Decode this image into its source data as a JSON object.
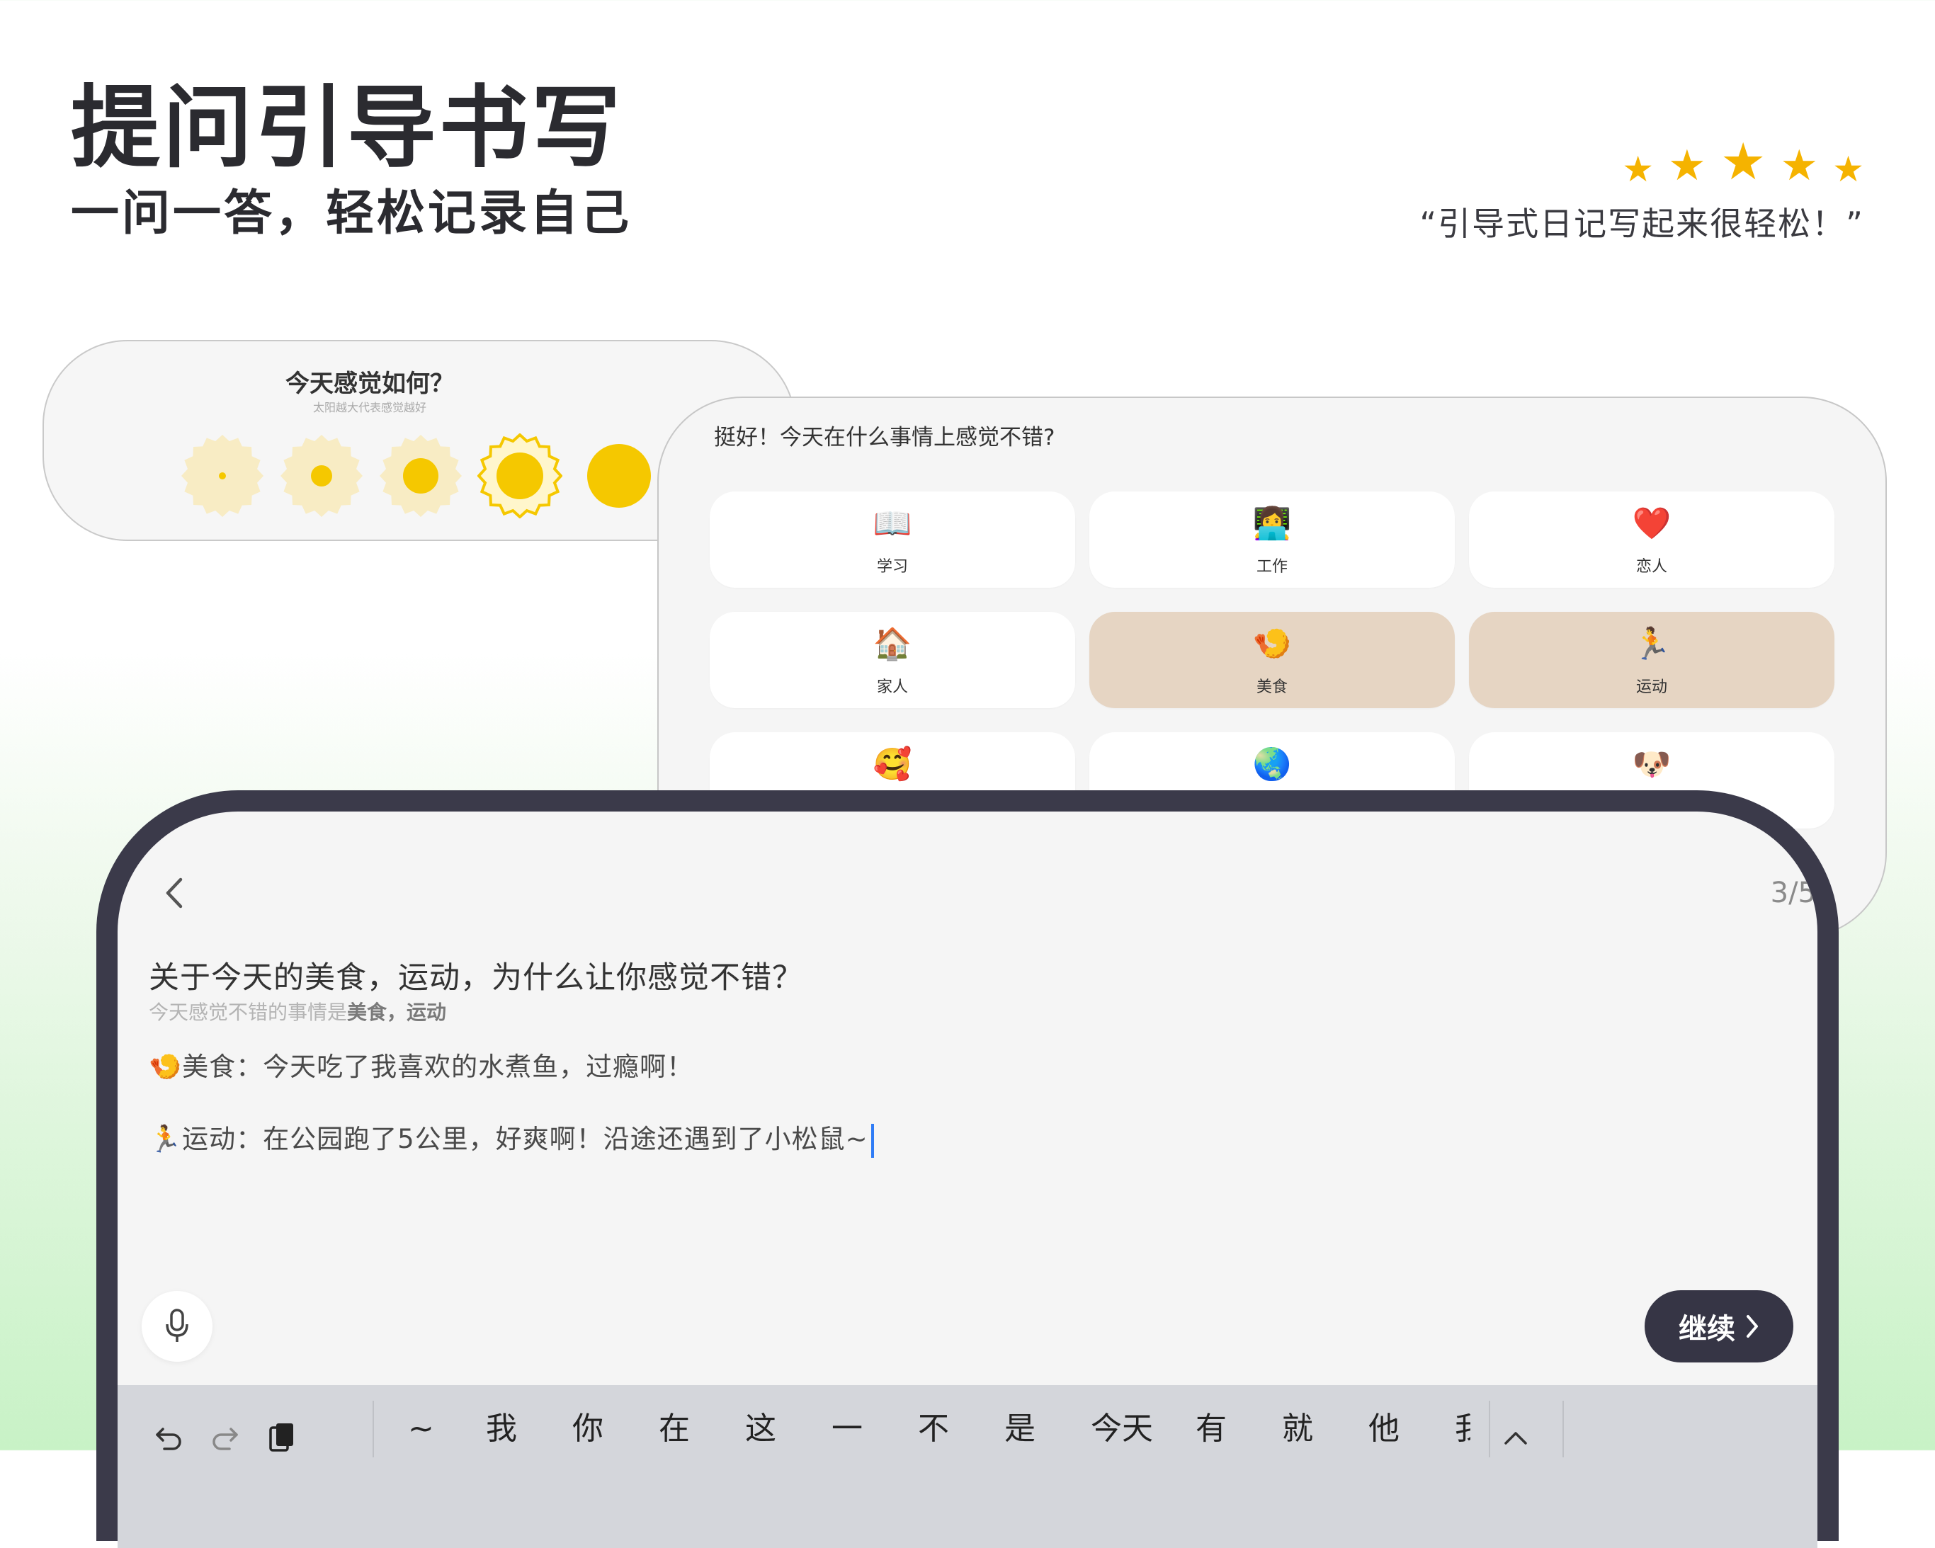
{
  "hero": {
    "title": "提问引导书写",
    "subtitle": "一问一答，轻松记录自己",
    "quote": "“引导式日记写起来很轻松！”",
    "rating_stars": 5
  },
  "feeling_card": {
    "title": "今天感觉如何？",
    "subtitle": "太阳越大代表感觉越好",
    "options": [
      1,
      2,
      3,
      4,
      5
    ],
    "selected": 4,
    "sun_color": "#f5c800"
  },
  "category_card": {
    "question": "挺好！今天在什么事情上感觉不错?",
    "categories": [
      {
        "icon": "📖",
        "icon_name": "book-icon",
        "label": "学习",
        "selected": false
      },
      {
        "icon": "👩‍💻",
        "icon_name": "technologist-icon",
        "label": "工作",
        "selected": false
      },
      {
        "icon": "❤️",
        "icon_name": "heart-icon",
        "label": "恋人",
        "selected": false
      },
      {
        "icon": "🏠",
        "icon_name": "house-icon",
        "label": "家人",
        "selected": false
      },
      {
        "icon": "🍤",
        "icon_name": "fried-shrimp-icon",
        "label": "美食",
        "selected": true
      },
      {
        "icon": "🏃",
        "icon_name": "runner-icon",
        "label": "运动",
        "selected": true
      },
      {
        "icon": "🥰",
        "icon_name": "smiling-hearts-icon",
        "label": "",
        "selected": false
      },
      {
        "icon": "🌏",
        "icon_name": "globe-icon",
        "label": "",
        "selected": false
      },
      {
        "icon": "🐶",
        "icon_name": "dog-face-icon",
        "label": "",
        "selected": false
      }
    ]
  },
  "editor": {
    "page_indicator": "3/5",
    "question": "关于今天的美食，运动，为什么让你感觉不错？",
    "hint_prefix": "今天感觉不错的事情是",
    "hint_tags": "美食，运动",
    "answers": [
      {
        "icon": "🍤",
        "text": "美食：今天吃了我喜欢的水煮鱼，过瘾啊！"
      },
      {
        "icon": "🏃",
        "text": "运动：在公园跑了5公里，好爽啊！沿途还遇到了小松鼠~"
      }
    ],
    "continue_label": "继续"
  },
  "keyboard": {
    "candidates": [
      "~",
      "我",
      "你",
      "在",
      "这",
      "一",
      "不",
      "是",
      "今天",
      "有",
      "就",
      "他",
      "我"
    ]
  },
  "colors": {
    "accent_dark": "#363545",
    "selected_tile": "#e6d5c3",
    "star": "#f5b300",
    "cursor": "#2f7cf6"
  }
}
